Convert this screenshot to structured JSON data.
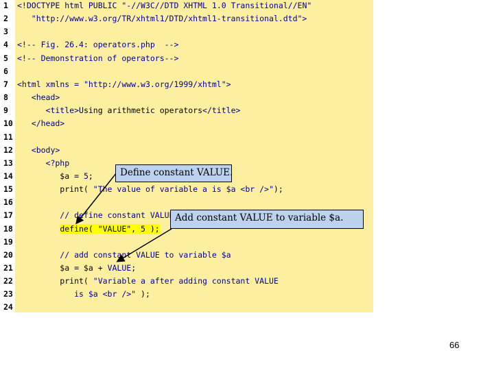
{
  "code": {
    "lines": [
      {
        "num": "1",
        "parts": [
          {
            "t": "<!DOCTYPE ",
            "c": "tag"
          },
          {
            "t": "html",
            "c": "tag"
          },
          {
            "t": " PUBLIC ",
            "c": "tag"
          },
          {
            "t": "\"-//W3C//DTD XHTML 1.0 Transitional//EN\"",
            "c": "str"
          }
        ]
      },
      {
        "num": "2",
        "parts": [
          {
            "t": "   \"http://www.w3.org/TR/xhtml1/DTD/xhtml1-transitional.dtd\">",
            "c": "str"
          }
        ]
      },
      {
        "num": "3",
        "parts": []
      },
      {
        "num": "4",
        "parts": [
          {
            "t": "<!-- Fig. 26.4: operators.php  -->",
            "c": "cmt"
          }
        ]
      },
      {
        "num": "5",
        "parts": [
          {
            "t": "<!-- Demonstration of operators-->",
            "c": "cmt"
          }
        ]
      },
      {
        "num": "6",
        "parts": []
      },
      {
        "num": "7",
        "parts": [
          {
            "t": "<html ",
            "c": "tag"
          },
          {
            "t": "xmlns = ",
            "c": "tag"
          },
          {
            "t": "\"http://www.w3.org/1999/xhtml\">",
            "c": "str"
          }
        ]
      },
      {
        "num": "8",
        "parts": [
          {
            "t": "   <head>",
            "c": "tag"
          }
        ]
      },
      {
        "num": "9",
        "parts": [
          {
            "t": "      <title>",
            "c": "tag"
          },
          {
            "t": "Using arithmetic operators",
            "c": ""
          },
          {
            "t": "</title>",
            "c": "tag"
          }
        ]
      },
      {
        "num": "10",
        "parts": [
          {
            "t": "   </head>",
            "c": "tag"
          }
        ]
      },
      {
        "num": "11",
        "parts": []
      },
      {
        "num": "12",
        "parts": [
          {
            "t": "   <body>",
            "c": "tag"
          }
        ]
      },
      {
        "num": "13",
        "parts": [
          {
            "t": "      <?php",
            "c": "tag"
          }
        ]
      },
      {
        "num": "14",
        "parts": [
          {
            "t": "         $a = ",
            "c": ""
          },
          {
            "t": "5",
            "c": "str"
          },
          {
            "t": ";",
            "c": ""
          }
        ]
      },
      {
        "num": "15",
        "parts": [
          {
            "t": "         print( ",
            "c": ""
          },
          {
            "t": "\"The value of variable a is $a <br />\"",
            "c": "str"
          },
          {
            "t": ");",
            "c": ""
          }
        ]
      },
      {
        "num": "16",
        "parts": []
      },
      {
        "num": "17",
        "parts": [
          {
            "t": "         // define constant VALUE",
            "c": "cmt"
          }
        ]
      },
      {
        "num": "18",
        "parts": [
          {
            "t": "         ",
            "c": ""
          },
          {
            "t": "define( \"VALUE\", 5 );",
            "c": "hl"
          }
        ]
      },
      {
        "num": "19",
        "parts": []
      },
      {
        "num": "20",
        "parts": [
          {
            "t": "         // add constant VALUE to variable $a",
            "c": "cmt"
          }
        ]
      },
      {
        "num": "21",
        "parts": [
          {
            "t": "         $a = $a + ",
            "c": ""
          },
          {
            "t": "VALUE",
            "c": "str"
          },
          {
            "t": ";",
            "c": ""
          }
        ]
      },
      {
        "num": "22",
        "parts": [
          {
            "t": "         print( ",
            "c": ""
          },
          {
            "t": "\"Variable a after adding constant VALUE",
            "c": "str"
          }
        ]
      },
      {
        "num": "23",
        "parts": [
          {
            "t": "            is $a <br />\"",
            "c": "str"
          },
          {
            "t": " );",
            "c": ""
          }
        ]
      },
      {
        "num": "24",
        "parts": []
      }
    ]
  },
  "callouts": {
    "define": "Define constant VALUE.",
    "add": "Add constant VALUE to variable $a."
  },
  "page_number": "66"
}
